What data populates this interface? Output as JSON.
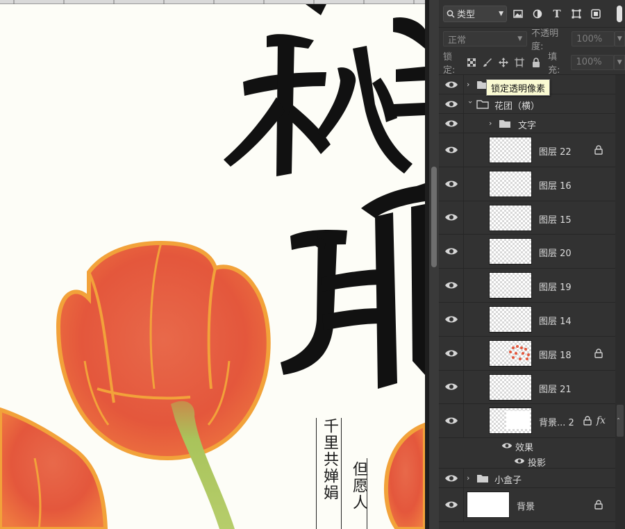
{
  "canvas": {
    "title_chars": [
      "秋",
      "月"
    ],
    "poem_line_1": "千里共婵娟",
    "poem_line_2": "但愿人"
  },
  "panel": {
    "filter": {
      "kind_label": "类型"
    },
    "blend": {
      "mode_label": "正常",
      "opacity_label": "不透明度:",
      "opacity_value": "100%"
    },
    "lock": {
      "label": "锁定:",
      "fill_label": "填充:",
      "fill_value": "100%"
    },
    "tooltip": "锁定透明像素",
    "layers": [
      {
        "name": "",
        "kind": "group",
        "depth": 0,
        "expanded": false
      },
      {
        "name": "花团（横）",
        "kind": "group",
        "depth": 0,
        "expanded": true
      },
      {
        "name": "文字",
        "kind": "group",
        "depth": 1,
        "expanded": false
      },
      {
        "name": "图层 22",
        "kind": "layer",
        "locked": true
      },
      {
        "name": "图层 16",
        "kind": "layer",
        "locked": false
      },
      {
        "name": "图层 15",
        "kind": "layer",
        "locked": false
      },
      {
        "name": "图层 20",
        "kind": "layer",
        "locked": false
      },
      {
        "name": "图层 19",
        "kind": "layer",
        "locked": false
      },
      {
        "name": "图层 14",
        "kind": "layer",
        "locked": false
      },
      {
        "name": "图层 18",
        "kind": "layer",
        "locked": true
      },
      {
        "name": "图层 21",
        "kind": "layer",
        "locked": false
      },
      {
        "name": "背景... 2",
        "kind": "layer",
        "locked": true,
        "fx": "fx"
      },
      {
        "name": "效果",
        "kind": "effects"
      },
      {
        "name": "投影",
        "kind": "effect"
      },
      {
        "name": "小盒子",
        "kind": "group",
        "depth": 0,
        "expanded": false
      },
      {
        "name": "背景",
        "kind": "background",
        "locked": true
      }
    ]
  },
  "colors": {
    "panel_bg": "#323232",
    "canvas_bg": "#fdfdf7",
    "petal_orange": "#e4573c",
    "petal_outline": "#f2a23a",
    "stem_green": "#a8c65a",
    "tooltip_bg": "#fafad2"
  }
}
